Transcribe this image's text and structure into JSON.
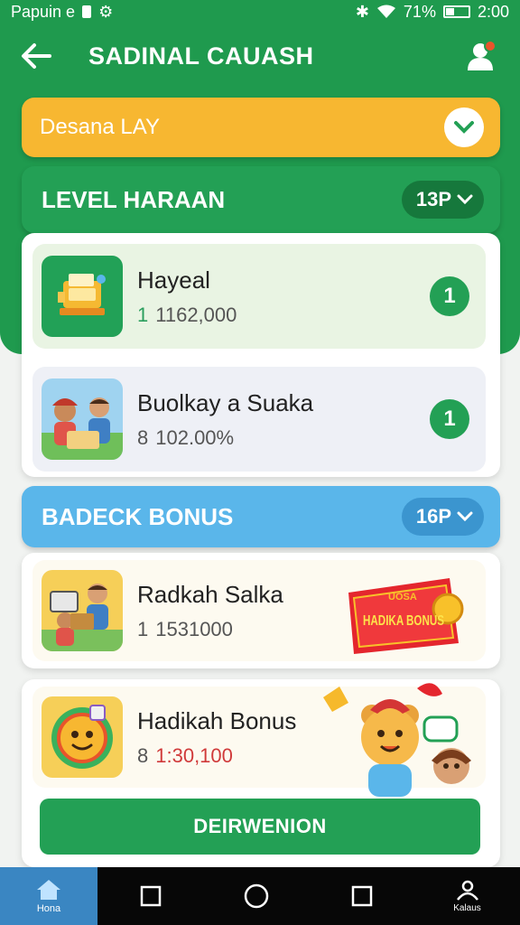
{
  "status_bar": {
    "left_text": "Papuin e",
    "battery": "71%",
    "time": "2:00"
  },
  "header": {
    "title": "SADINAL CAUASH"
  },
  "dropdown": {
    "label": "Desana LAY"
  },
  "level_section": {
    "title": "LEVEL HARAAN",
    "pill": "13P",
    "items": [
      {
        "name": "Hayeal",
        "value_prefix": "1",
        "value": "1162,000",
        "count": "1"
      },
      {
        "name": "Buolkay a Suaka",
        "value_prefix": "8",
        "value": "102.00%",
        "count": "1"
      }
    ]
  },
  "bonus_section": {
    "title": "BADECK BONUS",
    "pill": "16P",
    "items": [
      {
        "name": "Radkah Salka",
        "value_prefix": "1",
        "value": "1531000",
        "badge_top": "UOSA",
        "badge_main": "HADIKA BONUS"
      },
      {
        "name": "Hadikah Bonus",
        "value_prefix": "8",
        "value": "1:30,100"
      }
    ],
    "cta_label": "DEIRWENION"
  },
  "nav": {
    "home_label": "Hona",
    "profile_label": "Kalaus"
  },
  "colors": {
    "primary_green": "#1f9a4e",
    "amber": "#f7b731",
    "sky": "#5ab6ea",
    "bonus_red": "#e4262e"
  }
}
